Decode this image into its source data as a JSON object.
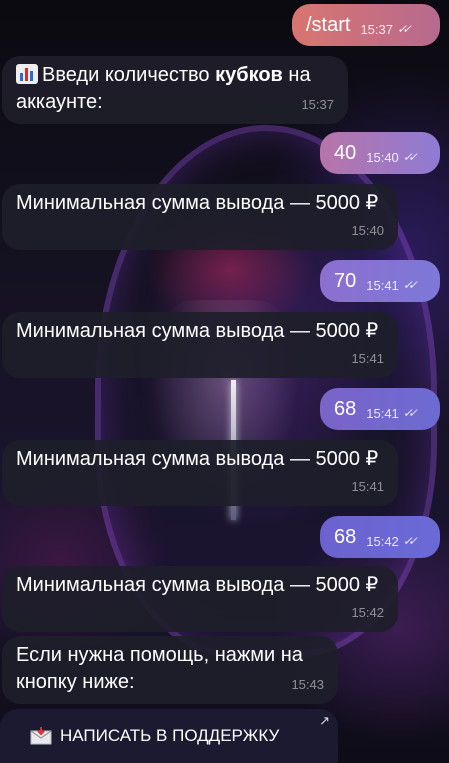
{
  "messages": [
    {
      "dir": "out",
      "text": "/start",
      "time": "15:37"
    },
    {
      "dir": "in",
      "text_pre": "Введи количество ",
      "text_bold": "кубков",
      "text_post": " на аккаунте:",
      "time": "15:37"
    },
    {
      "dir": "out",
      "text": "40",
      "time": "15:40"
    },
    {
      "dir": "in",
      "text": "Минимальная сумма вывода — 5000 ₽",
      "time": "15:40"
    },
    {
      "dir": "out",
      "text": "70",
      "time": "15:41"
    },
    {
      "dir": "in",
      "text": "Минимальная сумма вывода — 5000 ₽",
      "time": "15:41"
    },
    {
      "dir": "out",
      "text": "68",
      "time": "15:41"
    },
    {
      "dir": "in",
      "text": "Минимальная сумма вывода — 5000 ₽",
      "time": "15:41"
    },
    {
      "dir": "out",
      "text": "68",
      "time": "15:42"
    },
    {
      "dir": "in",
      "text": "Минимальная сумма вывода — 5000 ₽",
      "time": "15:42"
    },
    {
      "dir": "in",
      "text": "Если нужна помощь, нажми на кнопку ниже:",
      "time": "15:43"
    }
  ],
  "icons": {
    "chart": "bar-chart-emoji-icon",
    "read": "double-check-icon",
    "mail": "envelope-emoji-icon",
    "open": "external-arrow-icon"
  },
  "support_button": {
    "label": "НАПИСАТЬ В ПОДДЕРЖКУ"
  },
  "colors": {
    "out_start": "#d9756f",
    "out_end": "#7a6fd6",
    "in_bg": "#1e1e2a"
  }
}
